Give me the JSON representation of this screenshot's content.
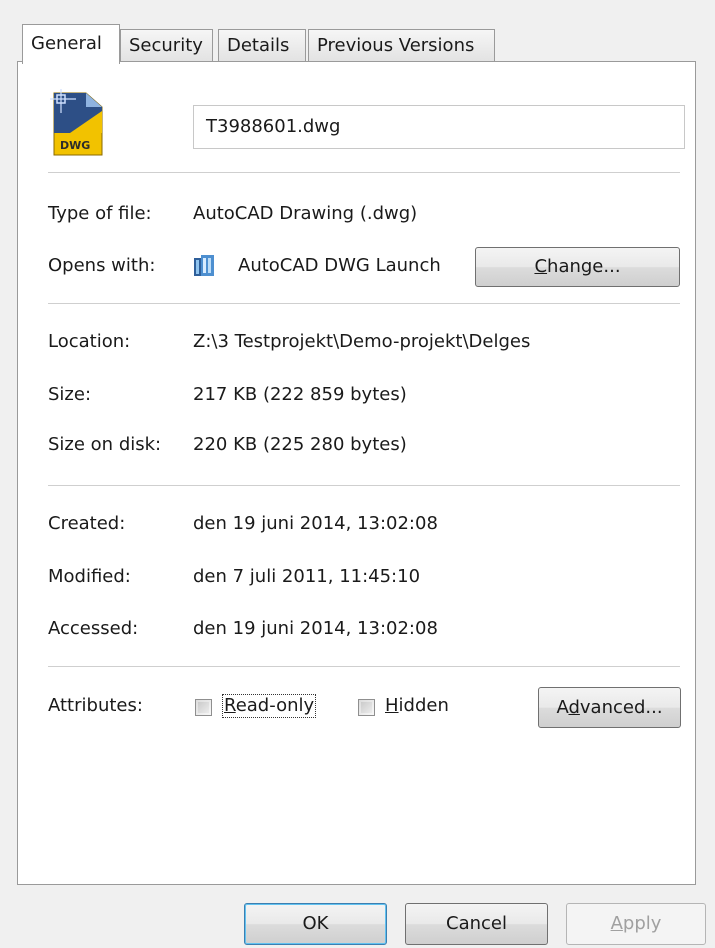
{
  "tabs": [
    {
      "label": "General",
      "active": true
    },
    {
      "label": "Security",
      "active": false
    },
    {
      "label": "Details",
      "active": false
    },
    {
      "label": "Previous Versions",
      "active": false
    }
  ],
  "file": {
    "icon": "dwg-file-icon",
    "icon_caption": "DWG",
    "name": "T3988601.dwg"
  },
  "fields": {
    "type_label": "Type of file:",
    "type_value": "AutoCAD Drawing (.dwg)",
    "opens_label": "Opens with:",
    "opens_value": "AutoCAD DWG Launch",
    "opens_icon": "autocad-launcher-icon",
    "change_button": {
      "pre": "",
      "key": "C",
      "post": "hange..."
    },
    "location_label": "Location:",
    "location_value": "Z:\\3 Testprojekt\\Demo-projekt\\Delges",
    "size_label": "Size:",
    "size_value": "217 KB (222 859 bytes)",
    "disk_label": "Size on disk:",
    "disk_value": "220 KB (225 280 bytes)",
    "created_label": "Created:",
    "created_value": "den 19 juni 2014, 13:02:08",
    "modified_label": "Modified:",
    "modified_value": "den 7 juli 2011, 11:45:10",
    "accessed_label": "Accessed:",
    "accessed_value": "den 19 juni 2014, 13:02:08"
  },
  "attributes": {
    "label": "Attributes:",
    "readonly": {
      "key": "R",
      "post": "ead-only",
      "checked": false
    },
    "hidden": {
      "key": "H",
      "post": "idden",
      "checked": false
    },
    "advanced_button": {
      "pre": "A",
      "key": "d",
      "post": "vanced..."
    }
  },
  "footer": {
    "ok": "OK",
    "cancel": "Cancel",
    "apply": {
      "key": "A",
      "post": "pply",
      "enabled": false
    }
  }
}
